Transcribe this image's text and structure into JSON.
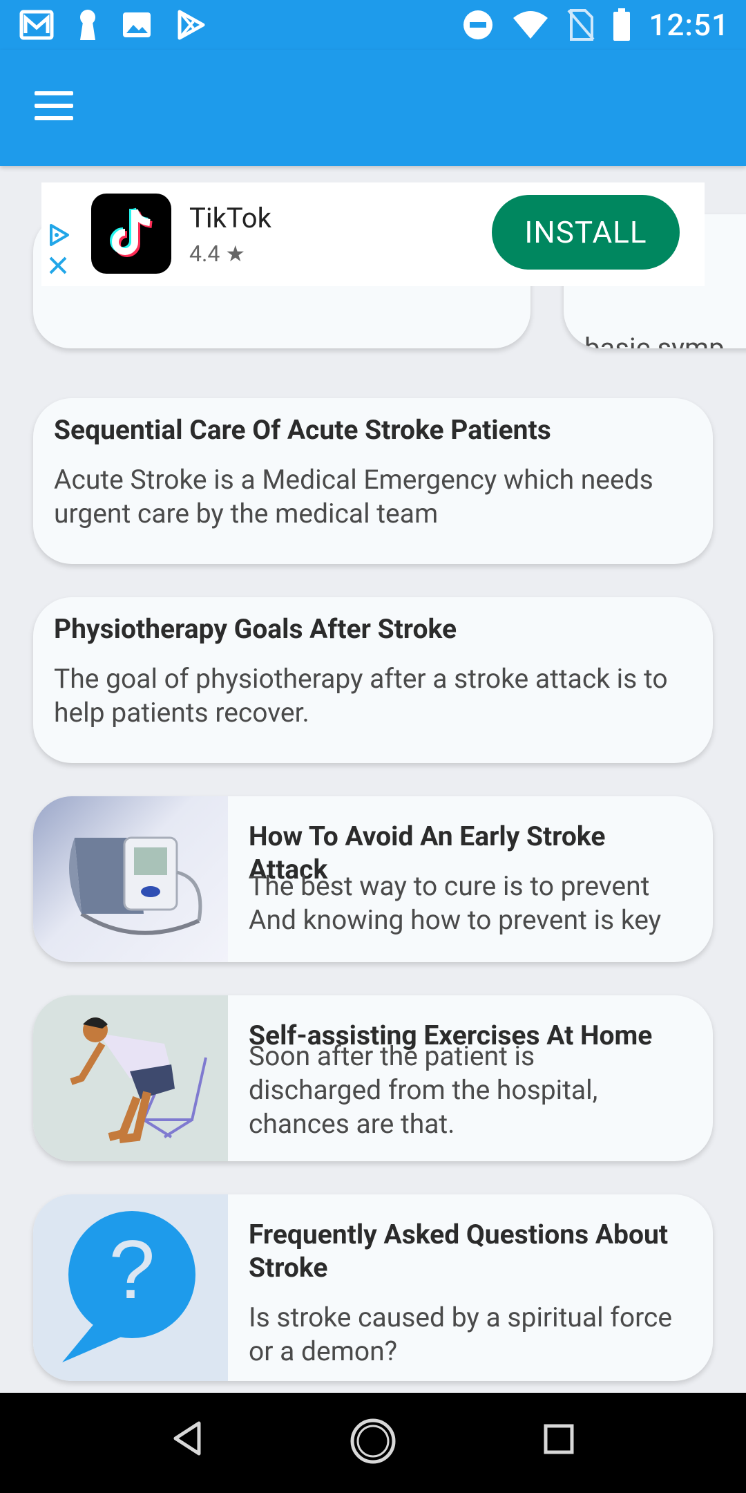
{
  "status_bar": {
    "time": "12:51",
    "left_icons": [
      "gmail-icon",
      "keyhole-icon",
      "image-icon",
      "play-store-icon"
    ],
    "right_icons": [
      "do-not-disturb-icon",
      "wifi-icon",
      "no-sim-icon",
      "battery-icon"
    ]
  },
  "app_bar": {
    "menu_icon": "hamburger-menu-icon"
  },
  "ad": {
    "app_name": "TikTok",
    "rating": "4.4 ★",
    "install_label": "INSTALL"
  },
  "partial_cards": {
    "right_snippet": "basic symp"
  },
  "cards": [
    {
      "title": "Sequential Care Of Acute Stroke Patients",
      "description": "Acute Stroke is a Medical Emergency which needs urgent care by the medical team"
    },
    {
      "title": "Physiotherapy Goals After Stroke",
      "description": "The goal of physiotherapy after a stroke attack is to help patients recover."
    },
    {
      "title": "How To Avoid An Early Stroke Attack",
      "description": "The best way to cure is to prevent And knowing how to prevent is key",
      "image": "blood-pressure-monitor-image"
    },
    {
      "title": "Self-assisting Exercises At Home",
      "description": "Soon after the patient is discharged from the hospital, chances are that.",
      "image": "exercise-illustration-image"
    },
    {
      "title": "Frequently Asked Questions About Stroke",
      "description": "Is stroke caused by a spiritual force or a demon?",
      "image": "question-bubble-image"
    }
  ],
  "colors": {
    "primary": "#1E9BEB",
    "install": "#00875F",
    "background": "#ECEEF2",
    "card": "#F7FAFC"
  }
}
